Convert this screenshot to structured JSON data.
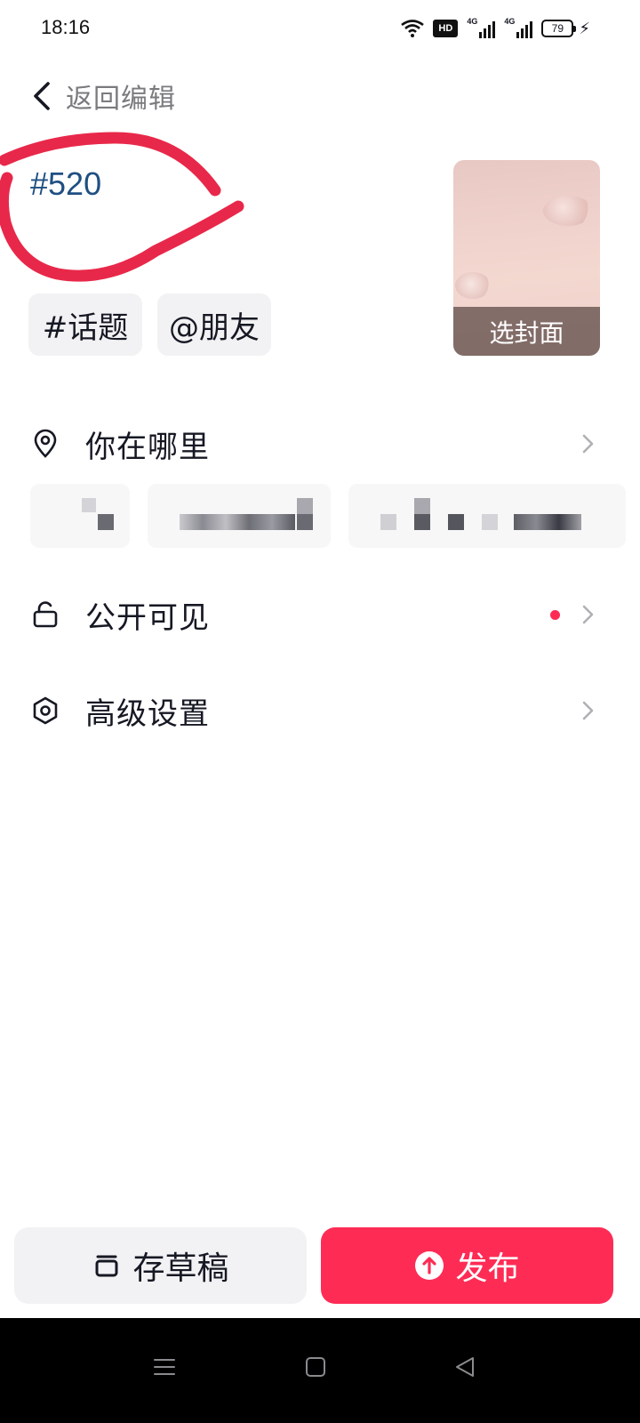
{
  "status_bar": {
    "time": "18:16",
    "hd_label": "HD",
    "signal1_label": "4G",
    "signal2_label": "4G",
    "battery_level": "79",
    "charging_icon": "bolt-icon"
  },
  "header": {
    "back_icon": "chevron-left-icon",
    "back_label": "返回编辑"
  },
  "post": {
    "caption": "#520",
    "topic_chip": "#话题",
    "friend_chip": "@朋友",
    "cover_label": "选封面"
  },
  "settings": {
    "location_label": "你在哪里",
    "visibility_label": "公开可见",
    "advanced_label": "高级设置"
  },
  "actions": {
    "draft_label": "存草稿",
    "publish_label": "发布"
  },
  "colors": {
    "accent": "#fe2c55",
    "caption_text": "#1f4f82",
    "annotation": "#e8284a"
  }
}
